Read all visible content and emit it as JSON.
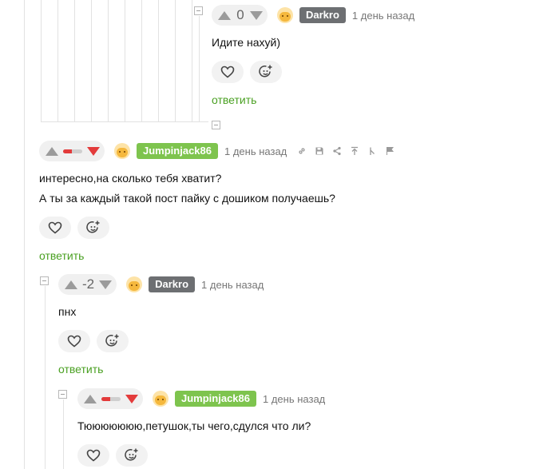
{
  "comments": [
    {
      "score": "0",
      "author": "Darkro",
      "time": "1 день назад",
      "lines": [
        "Идите нахуй)"
      ],
      "reply": "ответить"
    },
    {
      "rating_fraction": 0.45,
      "author": "Jumpinjack86",
      "time": "1 день назад",
      "lines": [
        "интересно,на сколько тебя хватит?",
        "А ты за каждый такой пост пайку с дошиком получаешь?"
      ],
      "reply": "ответить",
      "tools": [
        "link-icon",
        "save-icon",
        "share-icon",
        "jump-to-parent-icon",
        "branch-icon",
        "report-flag-icon"
      ]
    },
    {
      "score": "-2",
      "author": "Darkro",
      "time": "1 день назад",
      "lines": [
        "пнх"
      ],
      "reply": "ответить"
    },
    {
      "rating_fraction": 0.45,
      "author": "Jumpinjack86",
      "time": "1 день назад",
      "lines": [
        "Тююююююю,петушок,ты чего,сдулся что ли?"
      ]
    }
  ],
  "colors": {
    "reply_link": "#4aa022",
    "nick_green": "#7ec44e",
    "nick_gray": "#6d6f72",
    "downvote_red": "#e33b3b"
  },
  "icons": {
    "like": "heart-icon",
    "reaction": "add-emoji-icon",
    "collapse": "collapse-minus-icon"
  }
}
